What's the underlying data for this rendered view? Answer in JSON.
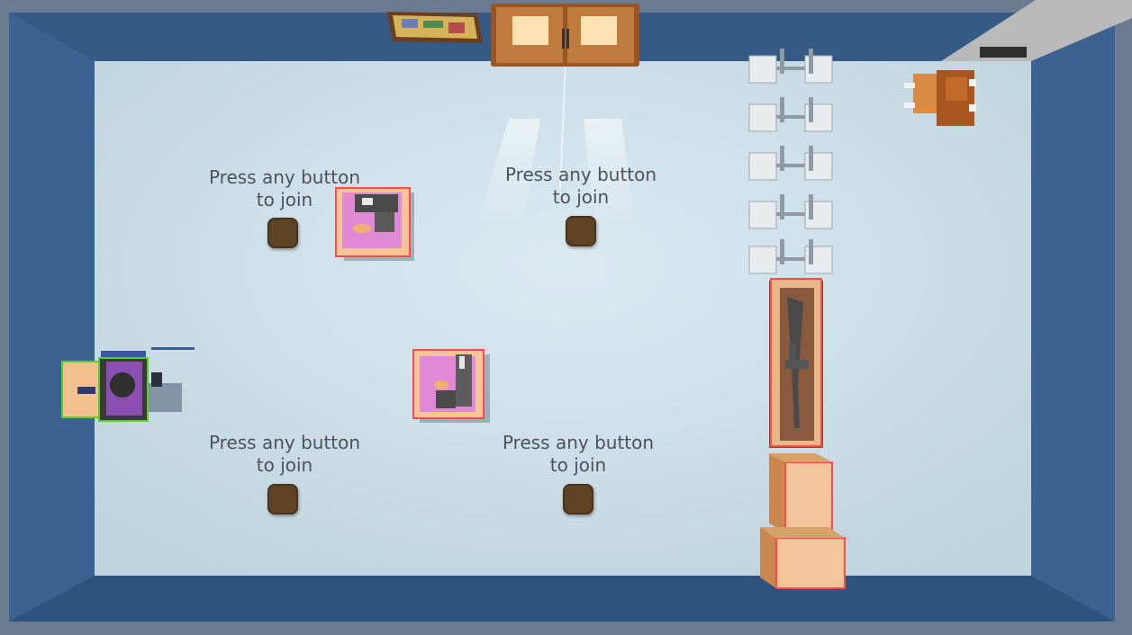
{
  "lobby": {
    "join_slots": [
      {
        "label": "Press any button\nto join"
      },
      {
        "label": "Press any button\nto join"
      },
      {
        "label": "Press any button\nto join"
      },
      {
        "label": "Press any button\nto join"
      }
    ]
  },
  "colors": {
    "floor": "#c9dde6",
    "wall": "#39608d",
    "outline_highlight": "#ff4a4a",
    "outline_player": "#55d12a",
    "wood": "#f0c08a",
    "door": "#b86a32"
  },
  "objects": {
    "chairs": 10,
    "items": [
      "assault-rifle-display",
      "crate",
      "crate",
      "weapon-crate",
      "weapon-crate",
      "player-character",
      "door",
      "notice-board",
      "desk-chair",
      "floor-mat"
    ]
  }
}
